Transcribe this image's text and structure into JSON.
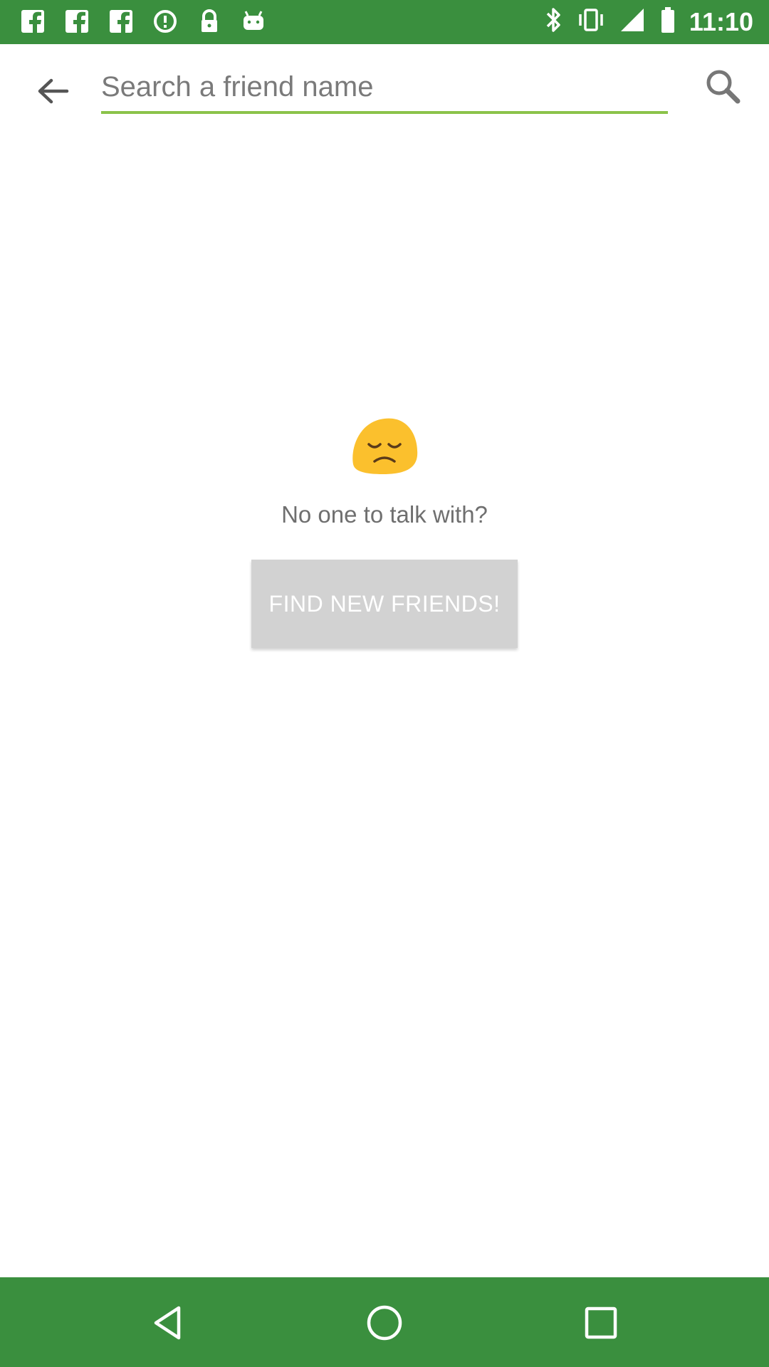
{
  "status_bar": {
    "time": "11:10",
    "left_icons": [
      "facebook-icon",
      "facebook-icon",
      "facebook-icon",
      "data-saver-icon",
      "lock-icon",
      "android-icon"
    ],
    "right_icons": [
      "bluetooth-icon",
      "vibrate-icon",
      "signal-icon",
      "battery-icon"
    ]
  },
  "toolbar": {
    "search_placeholder": "Search a friend name",
    "search_value": ""
  },
  "empty_state": {
    "message": "No one to talk with?",
    "button_label": "FIND NEW FRIENDS!"
  },
  "nav_bar": {
    "buttons": [
      "back-nav-icon",
      "home-nav-icon",
      "recents-nav-icon"
    ]
  },
  "colors": {
    "primary_green": "#3a8f3e",
    "accent_green": "#8bc34a",
    "button_gray": "#d2d2d2",
    "emoji_yellow": "#fbc02d"
  }
}
